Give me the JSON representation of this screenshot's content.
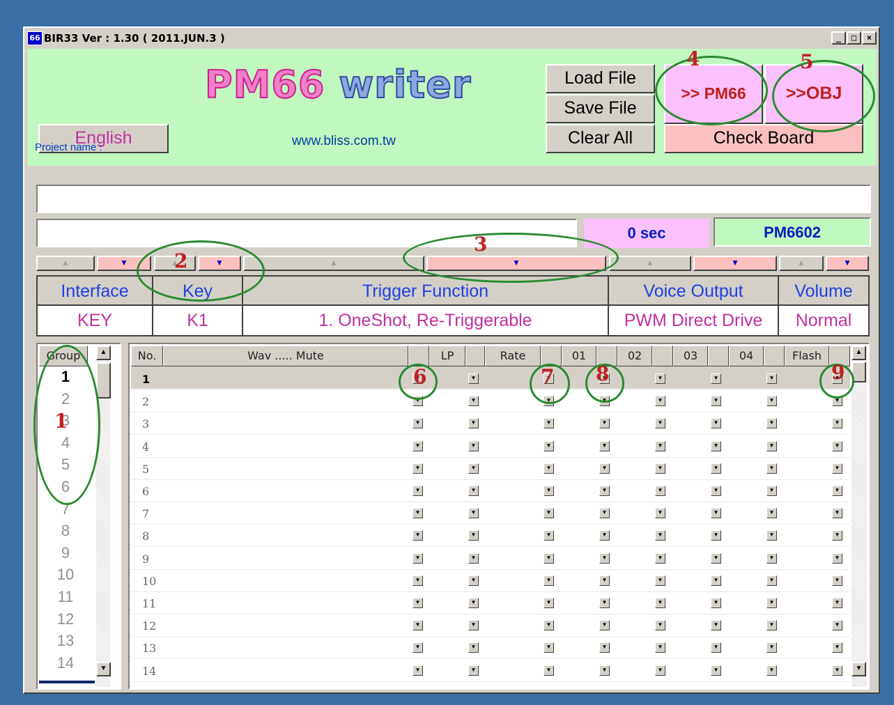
{
  "window": {
    "title": "BIR33 Ver : 1.30 ( 2011.JUN.3 )",
    "icon_text": "66",
    "minimize": "_",
    "maximize": "□",
    "close": "×"
  },
  "header": {
    "logo_left": "PM66",
    "logo_right": "writer",
    "language_button": "English",
    "url": "www.bliss.com.tw",
    "load_file": "Load File",
    "save_file": "Save File",
    "clear_all": "Clear All",
    "to_pm66": ">> PM66",
    "to_obj": ">>OBJ",
    "check_board": "Check Board"
  },
  "project": {
    "label": "Project name :",
    "name_value": "",
    "secondary_value": "",
    "time": "0 sec",
    "chip": "PM6602"
  },
  "config": {
    "headers": [
      "Interface",
      "Key",
      "Trigger Function",
      "Voice Output",
      "Volume"
    ],
    "values": [
      "KEY",
      "K1",
      "1. OneShot, Re-Triggerable",
      "PWM Direct Drive",
      "Normal"
    ]
  },
  "arrows": {
    "up": "▲",
    "down": "▼"
  },
  "groups": {
    "header": "Group",
    "items": [
      "1",
      "2",
      "3",
      "4",
      "5",
      "6",
      "7",
      "8",
      "9",
      "10",
      "11",
      "12",
      "13",
      "14"
    ],
    "selected": "1"
  },
  "grid": {
    "headers": {
      "no": "No.",
      "wav": "Wav ..... Mute",
      "lp": "LP",
      "rate": "Rate",
      "c01": "01",
      "c02": "02",
      "c03": "03",
      "c04": "04",
      "flash": "Flash"
    },
    "rows": [
      "1",
      "2",
      "3",
      "4",
      "5",
      "6",
      "7",
      "8",
      "9",
      "10",
      "11",
      "12",
      "13",
      "14"
    ]
  },
  "annotations": [
    "1",
    "2",
    "3",
    "4",
    "5",
    "6",
    "7",
    "8",
    "9"
  ],
  "colors": {
    "header_bg": "#c0f8c0",
    "down_arrow_bg": "#fcc0c0",
    "accent_text": "#2040e0",
    "value_text": "#c030a0",
    "annotation_red": "#c02020",
    "annotation_green": "#2a8a30"
  }
}
